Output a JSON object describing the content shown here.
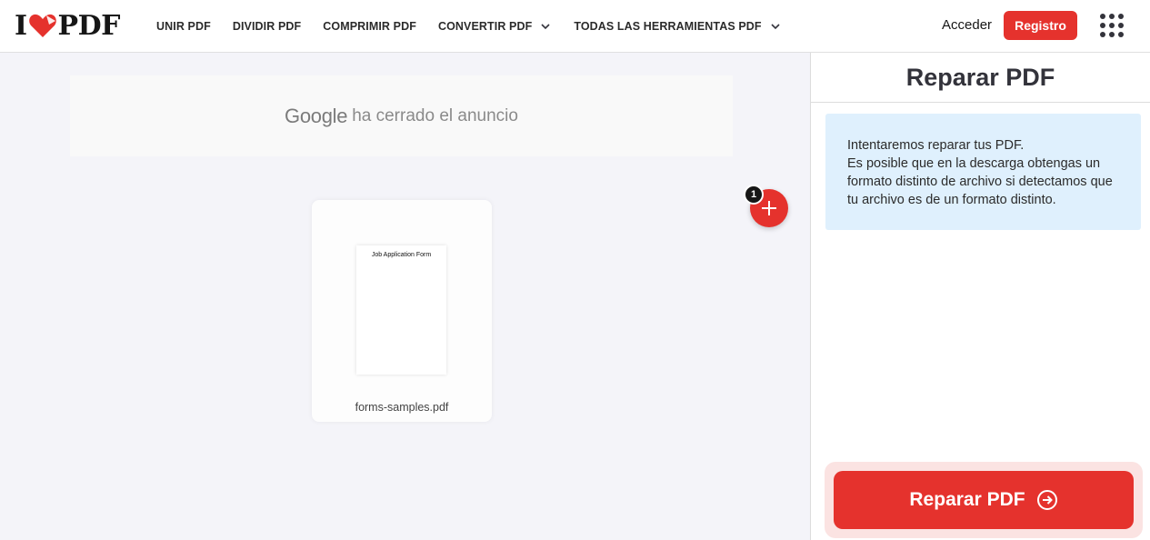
{
  "header": {
    "logo_left": "I",
    "logo_right": "PDF",
    "nav": [
      {
        "label": "UNIR PDF"
      },
      {
        "label": "DIVIDIR PDF"
      },
      {
        "label": "COMPRIMIR PDF"
      },
      {
        "label": "CONVERTIR PDF"
      },
      {
        "label": "TODAS LAS HERRAMIENTAS PDF"
      }
    ],
    "login_label": "Acceder",
    "register_label": "Registro"
  },
  "workspace": {
    "ad": {
      "brand": "Google",
      "text": "ha cerrado el anuncio"
    },
    "file": {
      "thumb_title": "Job Application Form",
      "name": "forms-samples.pdf"
    },
    "file_count": "1"
  },
  "sidebar": {
    "title": "Reparar PDF",
    "info_lines": [
      "Intentaremos reparar tus PDF.",
      "Es posible que en la descarga obtengas un formato distinto de archivo si detectamos que tu archivo es de un formato distinto."
    ],
    "action_label": "Reparar PDF"
  },
  "colors": {
    "brand_red": "#e5322d",
    "workspace_bg": "#f4f4f9",
    "info_bg": "#dff0fd"
  }
}
